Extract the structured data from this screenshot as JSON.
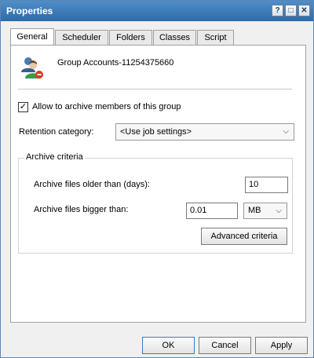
{
  "window": {
    "title": "Properties"
  },
  "titlebar": {
    "help_icon": "help-icon",
    "maximize_icon": "maximize-icon",
    "close_icon": "close-icon"
  },
  "tabs": [
    {
      "label": "General",
      "active": true
    },
    {
      "label": "Scheduler",
      "active": false
    },
    {
      "label": "Folders",
      "active": false
    },
    {
      "label": "Classes",
      "active": false
    },
    {
      "label": "Script",
      "active": false
    }
  ],
  "general": {
    "group_name": "Group Accounts-11254375660",
    "allow_archive": {
      "label": "Allow to archive members of this group",
      "checked": true
    },
    "retention": {
      "label": "Retention category:",
      "value": "<Use job settings>"
    },
    "archive_criteria": {
      "title": "Archive criteria",
      "older_than": {
        "label": "Archive files older than (days):",
        "value": "10"
      },
      "bigger_than": {
        "label": "Archive files bigger than:",
        "value": "0.01",
        "unit": "MB"
      },
      "advanced_label": "Advanced criteria"
    }
  },
  "footer": {
    "ok": "OK",
    "cancel": "Cancel",
    "apply": "Apply"
  }
}
